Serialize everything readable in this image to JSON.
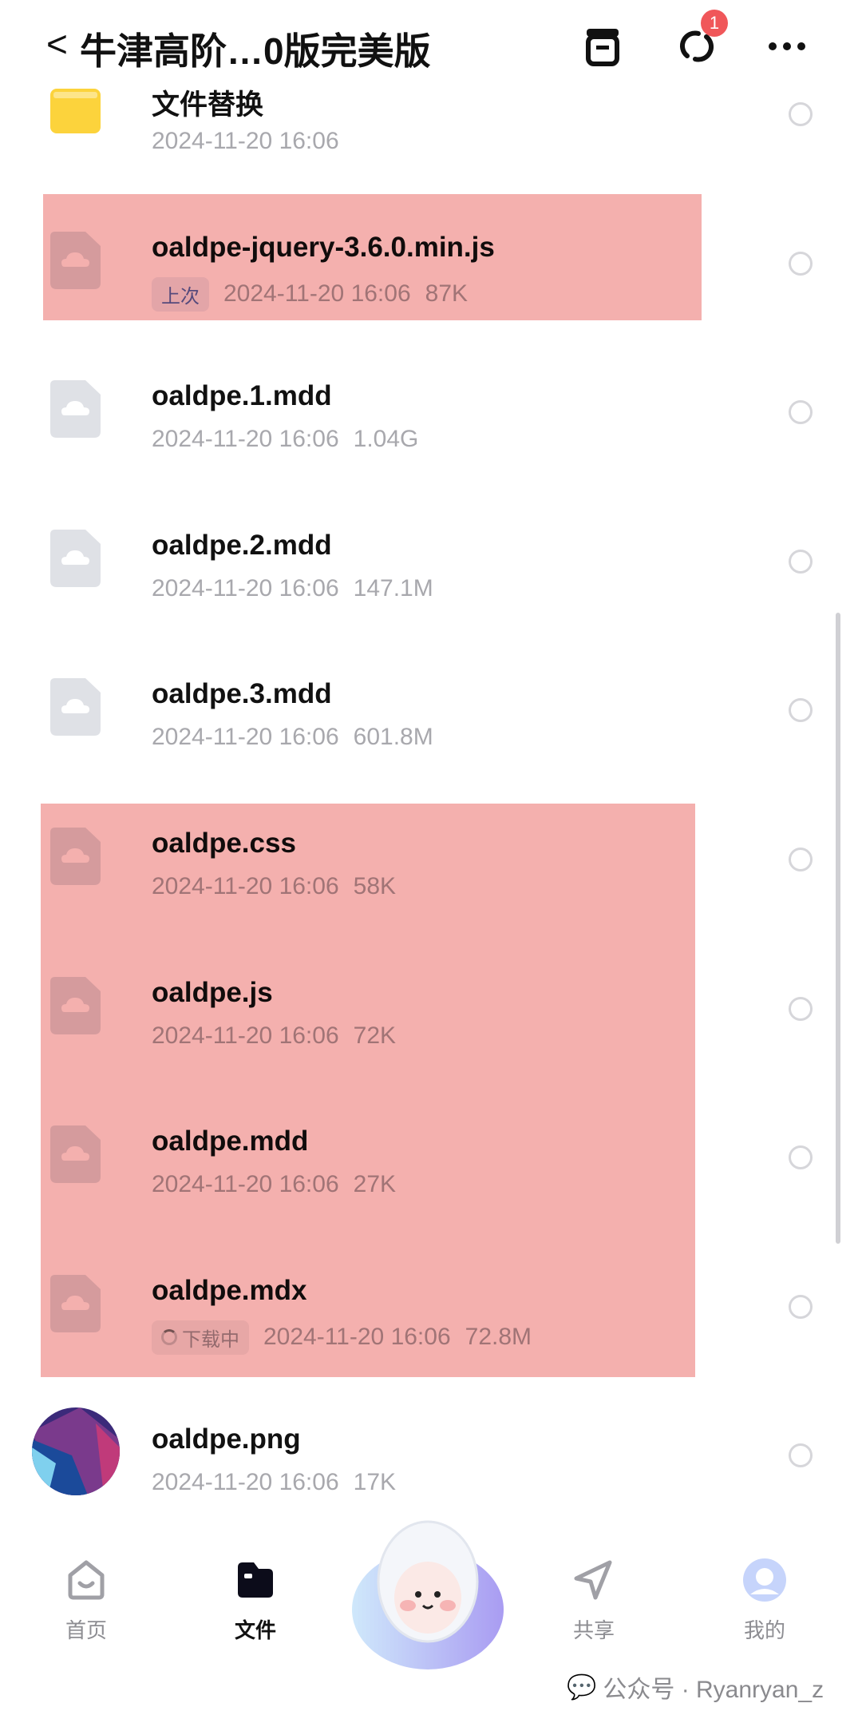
{
  "header": {
    "back_icon": "chevron-left-icon",
    "title": "牛津高阶…0版完美版",
    "sync_badge": "1"
  },
  "files": [
    {
      "name": "文件替换",
      "date": "2024-11-20 16:06",
      "size": "",
      "type": "folder",
      "tag": "",
      "highlighted": false
    },
    {
      "name": "oaldpe-jquery-3.6.0.min.js",
      "date": "2024-11-20 16:06",
      "size": "87K",
      "type": "cloud-file",
      "tag": "上次",
      "highlighted": true
    },
    {
      "name": "oaldpe.1.mdd",
      "date": "2024-11-20 16:06",
      "size": "1.04G",
      "type": "cloud-file",
      "tag": "",
      "highlighted": false
    },
    {
      "name": "oaldpe.2.mdd",
      "date": "2024-11-20 16:06",
      "size": "147.1M",
      "type": "cloud-file",
      "tag": "",
      "highlighted": false
    },
    {
      "name": "oaldpe.3.mdd",
      "date": "2024-11-20 16:06",
      "size": "601.8M",
      "type": "cloud-file",
      "tag": "",
      "highlighted": false
    },
    {
      "name": "oaldpe.css",
      "date": "2024-11-20 16:06",
      "size": "58K",
      "type": "cloud-file",
      "tag": "",
      "highlighted": true
    },
    {
      "name": "oaldpe.js",
      "date": "2024-11-20 16:06",
      "size": "72K",
      "type": "cloud-file",
      "tag": "",
      "highlighted": true
    },
    {
      "name": "oaldpe.mdd",
      "date": "2024-11-20 16:06",
      "size": "27K",
      "type": "cloud-file",
      "tag": "",
      "highlighted": true
    },
    {
      "name": "oaldpe.mdx",
      "date": "2024-11-20 16:06",
      "size": "72.8M",
      "type": "cloud-file",
      "tag": "下载中",
      "highlighted": true
    },
    {
      "name": "oaldpe.png",
      "date": "2024-11-20 16:06",
      "size": "17K",
      "type": "image",
      "tag": "",
      "highlighted": false
    }
  ],
  "nav": {
    "home": "首页",
    "files": "文件",
    "share": "共享",
    "mine": "我的"
  },
  "watermark": "公众号 · Ryanryan_z",
  "colors": {
    "highlight": "#f4b0ae",
    "badge": "#f0575a"
  }
}
